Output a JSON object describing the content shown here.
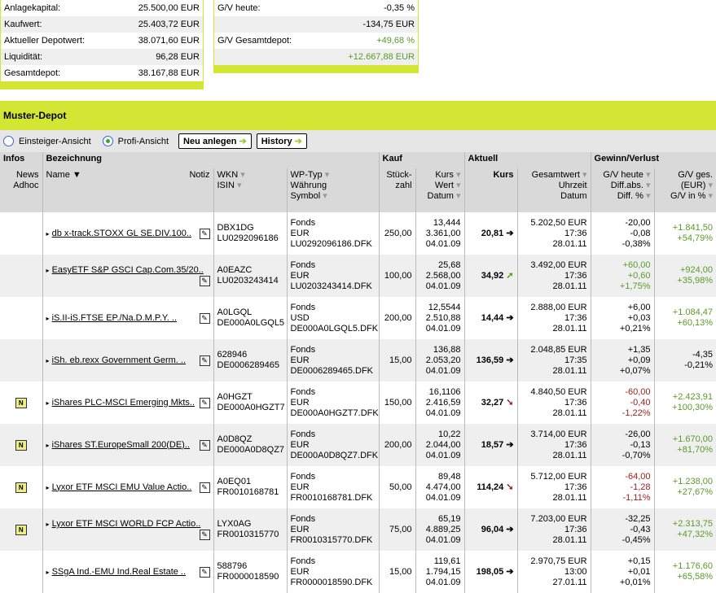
{
  "summary_left": [
    {
      "label": "Anlagekapital:",
      "value": "25.500,00 EUR"
    },
    {
      "label": "Kaufwert:",
      "value": "25.403,72 EUR"
    },
    {
      "label": "Aktueller Depotwert:",
      "value": "38.071,60 EUR"
    },
    {
      "label": "Liquidität:",
      "value": "96,28 EUR"
    },
    {
      "label": "Gesamtdepot:",
      "value": "38.167,88 EUR"
    }
  ],
  "summary_right": [
    {
      "label": "G/V heute:",
      "value": "-0,35 %",
      "tone": ""
    },
    {
      "label": "",
      "value": "-134,75 EUR",
      "tone": ""
    },
    {
      "label": "G/V Gesamtdepot:",
      "value": "+49,68 %",
      "tone": "pos"
    },
    {
      "label": "",
      "value": "+12.667,88 EUR",
      "tone": "pos"
    }
  ],
  "title": "Muster-Depot",
  "toolbar": {
    "einsteiger": "Einsteiger-Ansicht",
    "profi": "Profi-Ansicht",
    "neu": "Neu anlegen",
    "history": "History"
  },
  "groups": {
    "infos": "Infos",
    "bezeichnung": "Bezeichnung",
    "kauf": "Kauf",
    "aktuell": "Aktuell",
    "gv": "Gewinn/Verlust"
  },
  "headers": {
    "news": "News",
    "adhoc": "Adhoc",
    "name": "Name",
    "notiz": "Notiz",
    "wkn": "WKN",
    "isin": "ISIN",
    "wptyp": "WP-Typ",
    "waehrung": "Währung",
    "symbol": "Symbol",
    "stueck": "Stück-",
    "zahl": "zahl",
    "kurs": "Kurs",
    "wert": "Wert",
    "datum": "Datum",
    "akurs": "Kurs",
    "gesamtwert": "Gesamtwert",
    "uhrzeit": "Uhrzeit",
    "adatum": "Datum",
    "gvheute": "G/V heute",
    "diffabs": "Diff.abs.",
    "diffpct": "Diff. %",
    "gvges": "G/V ges.",
    "eur": "(EUR)",
    "gvin": "G/V in %"
  },
  "colors": {
    "accent": "#d4e634",
    "positive": "#5a9a2a",
    "negative": "#a02020"
  },
  "rows": [
    {
      "news": false,
      "name": "db x-track.STOXX GL SE.DIV.100..",
      "wkn": "DBX1DG",
      "isin": "LU0292096186",
      "typ": "Fonds",
      "cur": "EUR",
      "sym": "LU0292096186.DFK",
      "qty": "250,00",
      "kurs": "13,444",
      "wert": "3.361,00",
      "datum": "04.01.09",
      "akurs": "20,81",
      "trend": "flat",
      "gw": "5.202,50 EUR",
      "zeit": "17:36",
      "adatum": "28.01.11",
      "gvh": "-20,00",
      "dabs": "-0,08",
      "dpct": "-0,38%",
      "gvtone": "",
      "gvg": "+1.841,50",
      "gvp": "+54,79%",
      "gtone": "pos"
    },
    {
      "news": false,
      "name": "EasyETF S&P GSCI Cap.Com.35/20..",
      "wkn": "A0EAZC",
      "isin": "LU0203243414",
      "typ": "Fonds",
      "cur": "EUR",
      "sym": "LU0203243414.DFK",
      "qty": "100,00",
      "kurs": "25,68",
      "wert": "2.568,00",
      "datum": "04.01.09",
      "akurs": "34,92",
      "trend": "up",
      "gw": "3.492,00 EUR",
      "zeit": "17:36",
      "adatum": "28.01.11",
      "gvh": "+60,00",
      "dabs": "+0,60",
      "dpct": "+1,75%",
      "gvtone": "pos",
      "gvg": "+924,00",
      "gvp": "+35,98%",
      "gtone": "pos"
    },
    {
      "news": false,
      "name": "iS.II-iS.FTSE EP./Na.D.M.P.Y. ..",
      "wkn": "A0LGQL",
      "isin": "DE000A0LGQL5",
      "typ": "Fonds",
      "cur": "USD",
      "sym": "DE000A0LGQL5.DFK",
      "qty": "200,00",
      "kurs": "12,5544",
      "wert": "2.510,88",
      "datum": "04.01.09",
      "akurs": "14,44",
      "trend": "flat",
      "gw": "2.888,00 EUR",
      "zeit": "17:36",
      "adatum": "28.01.11",
      "gvh": "+6,00",
      "dabs": "+0,03",
      "dpct": "+0,21%",
      "gvtone": "",
      "gvg": "+1.084,47",
      "gvp": "+60,13%",
      "gtone": "pos"
    },
    {
      "news": false,
      "name": "iSh. eb.rexx Government Germ. ..",
      "wkn": "628946",
      "isin": "DE0006289465",
      "typ": "Fonds",
      "cur": "EUR",
      "sym": "DE0006289465.DFK",
      "qty": "15,00",
      "kurs": "136,88",
      "wert": "2.053,20",
      "datum": "04.01.09",
      "akurs": "136,59",
      "trend": "flat",
      "gw": "2.048,85 EUR",
      "zeit": "17:35",
      "adatum": "28.01.11",
      "gvh": "+1,35",
      "dabs": "+0,09",
      "dpct": "+0,07%",
      "gvtone": "",
      "gvg": "-4,35",
      "gvp": "-0,21%",
      "gtone": ""
    },
    {
      "news": true,
      "name": "iShares PLC-MSCI Emerging Mkts..",
      "wkn": "A0HGZT",
      "isin": "DE000A0HGZT7",
      "typ": "Fonds",
      "cur": "EUR",
      "sym": "DE000A0HGZT7.DFK",
      "qty": "150,00",
      "kurs": "16,1106",
      "wert": "2.416,59",
      "datum": "04.01.09",
      "akurs": "32,27",
      "trend": "down",
      "gw": "4.840,50 EUR",
      "zeit": "17:36",
      "adatum": "28.01.11",
      "gvh": "-60,00",
      "dabs": "-0,40",
      "dpct": "-1,22%",
      "gvtone": "neg",
      "gvg": "+2.423,91",
      "gvp": "+100,30%",
      "gtone": "pos"
    },
    {
      "news": true,
      "name": "iShares ST.EuropeSmall 200(DE)..",
      "wkn": "A0D8QZ",
      "isin": "DE000A0D8QZ7",
      "typ": "Fonds",
      "cur": "EUR",
      "sym": "DE000A0D8QZ7.DFK",
      "qty": "200,00",
      "kurs": "10,22",
      "wert": "2.044,00",
      "datum": "04.01.09",
      "akurs": "18,57",
      "trend": "flat",
      "gw": "3.714,00 EUR",
      "zeit": "17:36",
      "adatum": "28.01.11",
      "gvh": "-26,00",
      "dabs": "-0,13",
      "dpct": "-0,70%",
      "gvtone": "",
      "gvg": "+1.670,00",
      "gvp": "+81,70%",
      "gtone": "pos"
    },
    {
      "news": true,
      "name": "Lyxor ETF MSCI EMU Value Actio..",
      "wkn": "A0EQ01",
      "isin": "FR0010168781",
      "typ": "Fonds",
      "cur": "EUR",
      "sym": "FR0010168781.DFK",
      "qty": "50,00",
      "kurs": "89,48",
      "wert": "4.474,00",
      "datum": "04.01.09",
      "akurs": "114,24",
      "trend": "down",
      "gw": "5.712,00 EUR",
      "zeit": "17:36",
      "adatum": "28.01.11",
      "gvh": "-64,00",
      "dabs": "-1,28",
      "dpct": "-1,11%",
      "gvtone": "neg",
      "gvg": "+1.238,00",
      "gvp": "+27,67%",
      "gtone": "pos"
    },
    {
      "news": true,
      "name": "Lyxor ETF MSCI WORLD FCP Actio..",
      "wkn": "LYX0AG",
      "isin": "FR0010315770",
      "typ": "Fonds",
      "cur": "EUR",
      "sym": "FR0010315770.DFK",
      "qty": "75,00",
      "kurs": "65,19",
      "wert": "4.889,25",
      "datum": "04.01.09",
      "akurs": "96,04",
      "trend": "flat",
      "gw": "7.203,00 EUR",
      "zeit": "17:36",
      "adatum": "28.01.11",
      "gvh": "-32,25",
      "dabs": "-0,43",
      "dpct": "-0,45%",
      "gvtone": "",
      "gvg": "+2.313,75",
      "gvp": "+47,32%",
      "gtone": "pos"
    },
    {
      "news": false,
      "name": "SSgA Ind.-EMU Ind.Real Estate ..",
      "wkn": "588796",
      "isin": "FR0000018590",
      "typ": "Fonds",
      "cur": "EUR",
      "sym": "FR0000018590.DFK",
      "qty": "15,00",
      "kurs": "119,61",
      "wert": "1.794,15",
      "datum": "04.01.09",
      "akurs": "198,05",
      "trend": "flat",
      "gw": "2.970,75 EUR",
      "zeit": "13:00",
      "adatum": "27.01.11",
      "gvh": "+0,15",
      "dabs": "+0,01",
      "dpct": "+0,01%",
      "gvtone": "",
      "gvg": "+1.176,60",
      "gvp": "+65,58%",
      "gtone": "pos"
    }
  ]
}
